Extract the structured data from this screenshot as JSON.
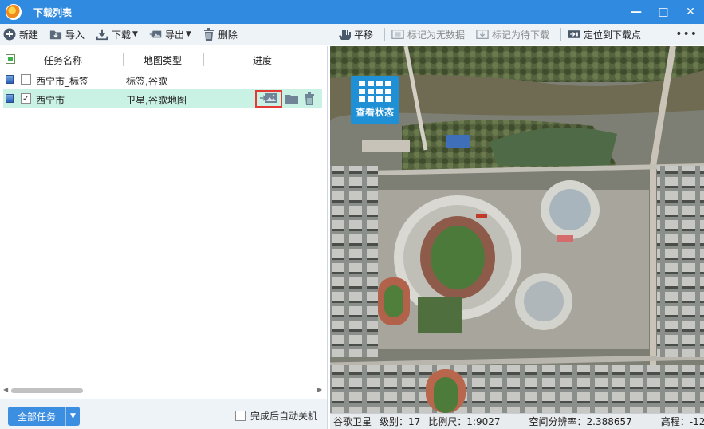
{
  "window": {
    "title": "下载列表",
    "controls": [
      "—",
      "□",
      "✕"
    ]
  },
  "toolbar": {
    "new_label": "新建",
    "import_label": "导入",
    "download_label": "下载",
    "export_label": "导出",
    "delete_label": "删除"
  },
  "map_toolbar": {
    "pan_label": "平移",
    "mark_nodata_label": "标记为无数据",
    "mark_pending_label": "标记为待下载",
    "locate_label": "定位到下载点",
    "more_label": "•••"
  },
  "task_list": {
    "headers": {
      "name": "任务名称",
      "type": "地图类型",
      "progress": "进度"
    },
    "rows": [
      {
        "name": "西宁市_标签",
        "type": "标签,谷歌",
        "checked": false,
        "selected": false
      },
      {
        "name": "西宁市",
        "type": "卫星,谷歌地图",
        "checked": true,
        "selected": true
      }
    ]
  },
  "bottom": {
    "all_tasks_label": "全部任务",
    "auto_shutdown_label": "完成后自动关机"
  },
  "map": {
    "status_button_label": "查看状态"
  },
  "map_status": {
    "source": "谷歌卫星",
    "level": "级别：17",
    "scale": "比例尺：1:9027",
    "resolution": "空间分辨率：2.388657",
    "elevation": "高程：-12"
  }
}
